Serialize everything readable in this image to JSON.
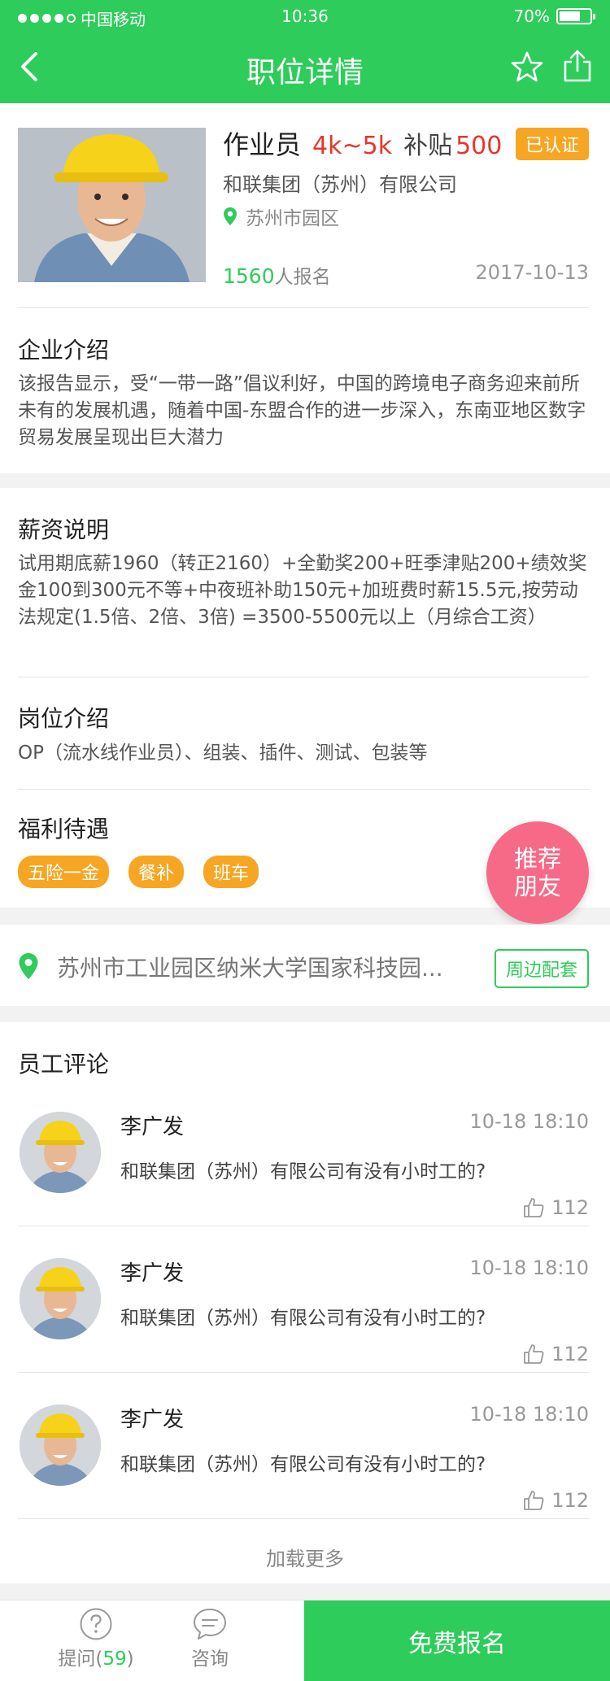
{
  "status_bar": {
    "carrier": "中国移动",
    "time": "10:36",
    "battery": "70%",
    "battery_level": 0.7
  },
  "nav": {
    "title": "职位详情"
  },
  "job": {
    "title": "作业员",
    "salary": "4k~5k",
    "subsidy_label": "补贴",
    "subsidy_value": "500",
    "certified": "已认证",
    "company": "和联集团（苏州）有限公司",
    "location": "苏州市园区",
    "apply_count": "1560",
    "apply_suffix": "人报名",
    "date": "2017-10-13"
  },
  "company_intro": {
    "title": "企业介绍",
    "text": "该报告显示，受“一带一路”倡议利好，中国的跨境电子商务迎来前所未有的发展机遇，随着中国-东盟合作的进一步深入，东南亚地区数字贸易发展呈现出巨大潜力"
  },
  "salary_info": {
    "title": "薪资说明",
    "text": "试用期底薪1960（转正2160）+全勤奖200+旺季津贴200+绩效奖金100到300元不等+中夜班补助150元+加班费时薪15.5元,按劳动法规定(1.5倍、2倍、3倍) =3500-5500元以上（月综合工资）"
  },
  "position_info": {
    "title": "岗位介绍",
    "text": "OP（流水线作业员）、组装、插件、测试、包装等"
  },
  "benefits": {
    "title": "福利待遇",
    "tags": [
      "五险一金",
      "餐补",
      "班车"
    ]
  },
  "recommend": {
    "line1": "推荐",
    "line2": "朋友"
  },
  "address": {
    "text": "苏州市工业园区纳米大学国家科技园...",
    "button": "周边配套"
  },
  "reviews": {
    "title": "员工评论",
    "items": [
      {
        "name": "李广发",
        "time": "10-18 18:10",
        "text": "和联集团（苏州）有限公司有没有小时工的?",
        "likes": "112"
      },
      {
        "name": "李广发",
        "time": "10-18 18:10",
        "text": "和联集团（苏州）有限公司有没有小时工的?",
        "likes": "112"
      },
      {
        "name": "李广发",
        "time": "10-18 18:10",
        "text": "和联集团（苏州）有限公司有没有小时工的?",
        "likes": "112"
      }
    ],
    "load_more": "加载更多"
  },
  "bottom": {
    "ask_label": "提问(",
    "ask_count": "59",
    "ask_close": ")",
    "consult_label": "咨询",
    "signup": "免费报名"
  },
  "colors": {
    "brand": "#2ecc5b",
    "salary": "#e8352c",
    "badge": "#f6a623",
    "recommend": "#f66a88"
  }
}
